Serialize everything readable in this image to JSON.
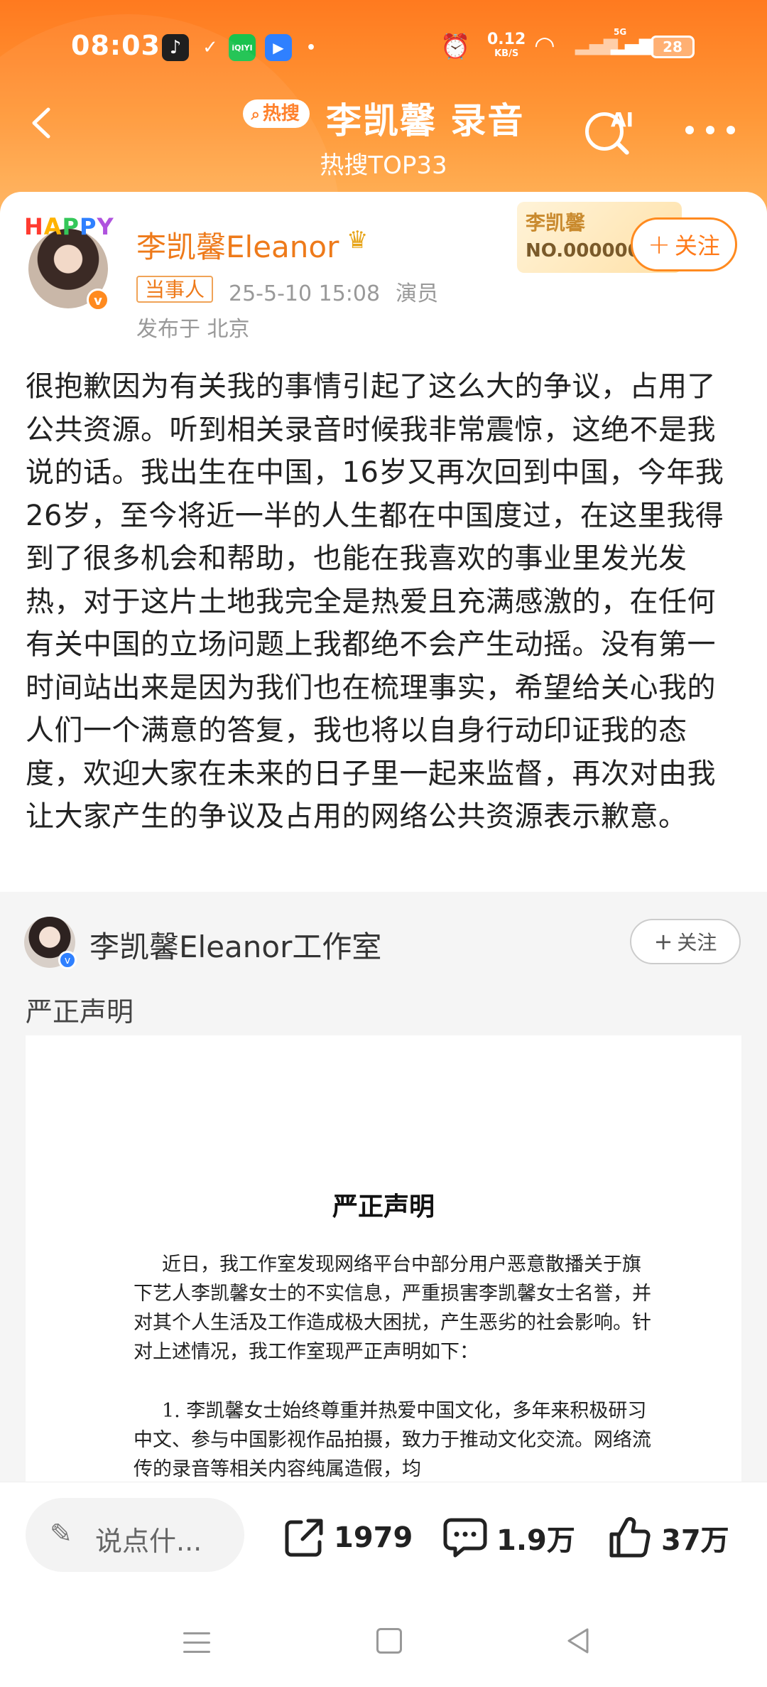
{
  "status_bar": {
    "time": "08:03",
    "net_speed": "0.12",
    "net_unit": "KB/S",
    "network": "5G",
    "battery": "28"
  },
  "header": {
    "hot_badge": "热搜",
    "title": "李凯馨 录音",
    "subtitle": "热搜TOP33",
    "ai_label": "AI",
    "accent_color": "#ff7a1f"
  },
  "post": {
    "avatar_frame": "HAPPY",
    "author": "李凯馨Eleanor",
    "tag": "当事人",
    "date": "25-5-10 15:08",
    "role": "演员",
    "location": "发布于 北京",
    "fan_card_name": "李凯馨",
    "fan_card_no": "NO.000000",
    "follow_label": "关注",
    "content": "很抱歉因为有关我的事情引起了这么大的争议，占用了公共资源。听到相关录音时候我非常震惊，这绝不是我说的话。我出生在中国，16岁又再次回到中国，今年我26岁，至今将近一半的人生都在中国度过，在这里我得到了很多机会和帮助，也能在我喜欢的事业里发光发热，对于这片土地我完全是热爱且充满感激的，在任何有关中国的立场问题上我都绝不会产生动摇。没有第一时间站出来是因为我们也在梳理事实，希望给关心我的人们一个满意的答复，我也将以自身行动印证我的态度，欢迎大家在未来的日子里一起来监督，再次对由我让大家产生的争议及占用的网络公共资源表示歉意。"
  },
  "repost": {
    "author": "李凯馨Eleanor工作室",
    "follow_label": "关注",
    "text": "严正声明",
    "doc_title": "严正声明",
    "doc_para1": "近日，我工作室发现网络平台中部分用户恶意散播关于旗下艺人李凯馨女士的不实信息，严重损害李凯馨女士名誉，并对其个人生活及工作造成极大困扰，产生恶劣的社会影响。针对上述情况，我工作室现严正声明如下：",
    "doc_para2": "1. 李凯馨女士始终尊重并热爱中国文化，多年来积极研习中文、参与中国影视作品拍摄，致力于推动文化交流。网络流传的录音等相关内容纯属造假，均"
  },
  "action_bar": {
    "comment_placeholder": "说点什...",
    "shares": "1979",
    "comments": "1.9万",
    "likes": "37万"
  }
}
